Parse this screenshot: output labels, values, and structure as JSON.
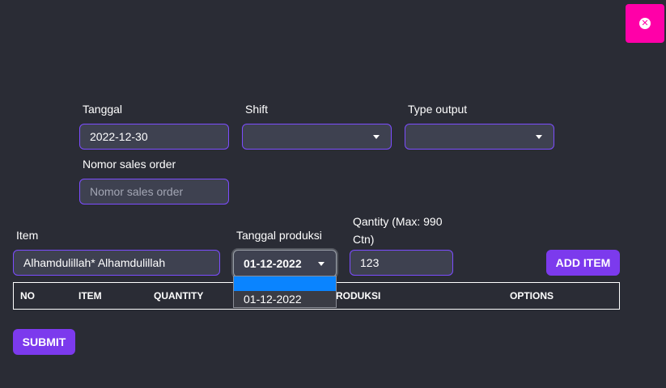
{
  "colors": {
    "background": "#2a2c35",
    "close_button": "#ff00a8",
    "field_border": "#7c4dff",
    "primary_button": "#7c3aed",
    "dropdown_highlight": "#0a84ff"
  },
  "close_icon": "x-circle-icon",
  "form": {
    "tanggal": {
      "label": "Tanggal",
      "value": "2022-12-30"
    },
    "shift": {
      "label": "Shift",
      "value": ""
    },
    "type_output": {
      "label": "Type output",
      "value": ""
    },
    "nomor_sales_order": {
      "label": "Nomor sales order",
      "placeholder": "Nomor sales order"
    },
    "item": {
      "label": "Item",
      "value": "Alhamdulillah* Alhamdulillah"
    },
    "tanggal_produksi": {
      "label": "Tanggal produksi",
      "value": "01-12-2022",
      "options": [
        "",
        "01-12-2022"
      ]
    },
    "quantity": {
      "label_line1": "Qantity (Max: 990",
      "label_line2": "Ctn)",
      "value": "123"
    },
    "add_item_label": "ADD ITEM"
  },
  "table": {
    "headers": [
      "NO",
      "ITEM",
      "QUANTITY",
      "RODUKSI",
      "OPTIONS"
    ]
  },
  "submit_label": "SUBMIT"
}
